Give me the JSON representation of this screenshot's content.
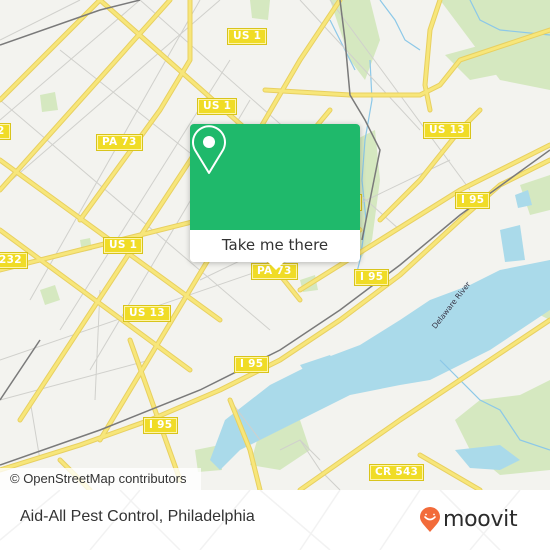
{
  "map": {
    "shields": [
      {
        "label": "US 1",
        "id": "us1-north"
      },
      {
        "label": "US 1",
        "id": "us1-mid"
      },
      {
        "label": "US 13",
        "id": "us13-northeast"
      },
      {
        "label": "PA 73",
        "id": "pa73-west"
      },
      {
        "label": "PA 73",
        "id": "pa73-center"
      },
      {
        "label": "US 1",
        "id": "us1-west"
      },
      {
        "label": "US 13",
        "id": "us13-southwest"
      },
      {
        "label": "I 95",
        "id": "i95-east"
      },
      {
        "label": "I 95",
        "id": "i95-center"
      },
      {
        "label": "I 95",
        "id": "i95-mid"
      },
      {
        "label": "I 95",
        "id": "i95-southwest"
      },
      {
        "label": "CR 543",
        "id": "cr543"
      },
      {
        "label": "232",
        "id": "r232"
      },
      {
        "label": "2",
        "id": "r2-edge"
      },
      {
        "label": "",
        "id": "edge-shield-left"
      },
      {
        "label": "",
        "id": "edge-shield-right"
      }
    ],
    "river_label": "Delaware River",
    "attribution": "© OpenStreetMap contributors",
    "colors": {
      "land": "#f3f3ef",
      "water": "#aadaea",
      "park": "#d5e8c0",
      "major_road": "#f6e36b",
      "minor_road": "#cfcfcf",
      "rail": "#777777"
    }
  },
  "popup": {
    "icon": "map-pin-icon",
    "button_label": "Take me there",
    "color": "#1fb96b"
  },
  "footer": {
    "place_title": "Aid-All Pest Control, Philadelphia",
    "logo_text": "moovit",
    "logo_icon": "moovit-smiley-pin-icon",
    "logo_color": "#f26b3a"
  }
}
